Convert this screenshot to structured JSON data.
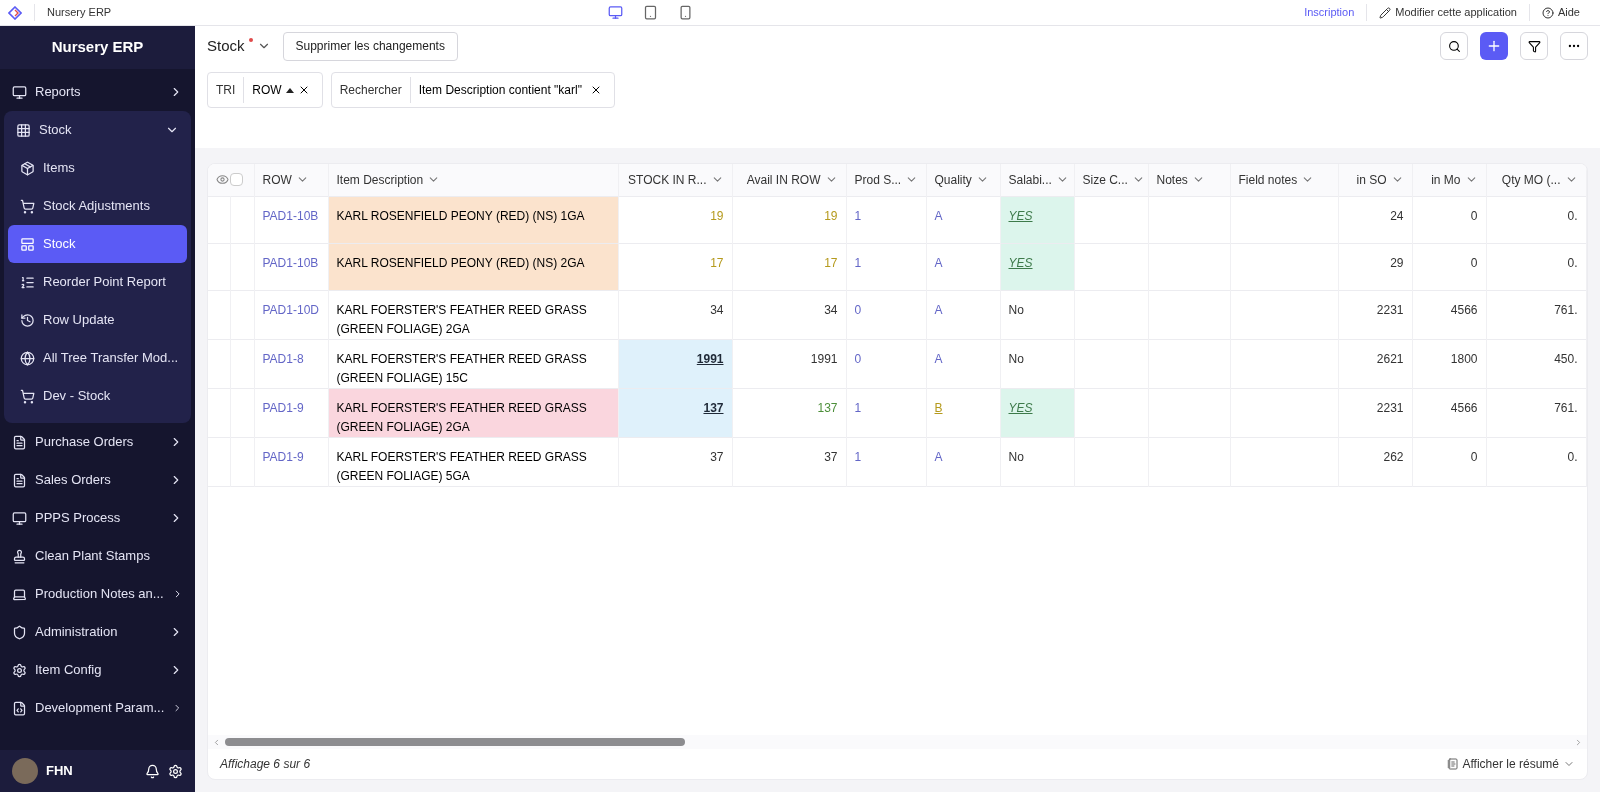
{
  "topbar": {
    "app_name": "Nursery ERP",
    "device_views": [
      {
        "kind": "desktop",
        "selected": true
      },
      {
        "kind": "tablet",
        "selected": false
      },
      {
        "kind": "phone",
        "selected": false
      }
    ],
    "signup": "Inscription",
    "edit_app": "Modifier cette application",
    "help": "Aide"
  },
  "sidebar": {
    "title": "Nursery ERP",
    "items": [
      {
        "label": "Reports",
        "expanded": false,
        "selected": false
      },
      {
        "label": "Stock",
        "expanded": true,
        "selected": false,
        "children": [
          {
            "label": "Items",
            "selected": false
          },
          {
            "label": "Stock Adjustments",
            "selected": false
          },
          {
            "label": "Stock",
            "selected": true
          },
          {
            "label": "Reorder Point Report",
            "selected": false
          },
          {
            "label": "Row Update",
            "selected": false
          },
          {
            "label": "All Tree Transfer Mod...",
            "selected": false
          },
          {
            "label": "Dev - Stock",
            "selected": false
          }
        ]
      },
      {
        "label": "Purchase Orders",
        "expanded": false,
        "selected": false
      },
      {
        "label": "Sales Orders",
        "expanded": false,
        "selected": false
      },
      {
        "label": "PPPS Process",
        "expanded": false,
        "selected": false
      },
      {
        "label": "Clean Plant Stamps",
        "selected": false
      },
      {
        "label": "Production Notes an...",
        "expanded": false,
        "selected": false
      },
      {
        "label": "Administration",
        "expanded": false,
        "selected": false
      },
      {
        "label": "Item Config",
        "expanded": false,
        "selected": false
      },
      {
        "label": "Development Param...",
        "expanded": false,
        "selected": false
      }
    ],
    "user": {
      "name": "FHN"
    }
  },
  "header": {
    "title": "Stock",
    "unsaved": true,
    "discard_button": "Supprimer les changements"
  },
  "filters": {
    "sort_label": "TRI",
    "sort_chip": "ROW",
    "sort_ascending": true,
    "search_label": "Rechercher",
    "search_chip": "Item Description contient \"karl\""
  },
  "table": {
    "all_selected": false,
    "columns": [
      "ROW",
      "Item Description",
      "STOCK IN R...",
      "Avail IN ROW",
      "Prod S...",
      "Quality",
      "Salabi...",
      "Size C...",
      "Notes",
      "Field notes",
      "in SO",
      "in Mo",
      "Qty MO (..."
    ],
    "rows": [
      {
        "row": "PAD1-10B",
        "description": {
          "text": "KARL ROSENFIELD PEONY (RED) (NS) 1GA",
          "color": "#fbe3cd"
        },
        "stock": {
          "text": "19",
          "kind": "number",
          "color": "#b59a1d"
        },
        "avail": {
          "text": "19",
          "color": "#b59a1d"
        },
        "prod": "1",
        "quality": {
          "text": "A",
          "kind": "plain",
          "color": "#6366c7"
        },
        "salability": "YES",
        "salable": true,
        "in_so": "24",
        "in_mo": "0",
        "qty_mo": "0."
      },
      {
        "row": "PAD1-10B",
        "description": {
          "text": "KARL ROSENFIELD PEONY (RED) (NS) 2GA",
          "color": "#fbe3cd"
        },
        "stock": {
          "text": "17",
          "kind": "number",
          "color": "#b59a1d"
        },
        "avail": {
          "text": "17",
          "color": "#b59a1d"
        },
        "prod": "1",
        "quality": {
          "text": "A",
          "kind": "plain",
          "color": "#6366c7"
        },
        "salability": "YES",
        "salable": true,
        "in_so": "29",
        "in_mo": "0",
        "qty_mo": "0."
      },
      {
        "row": "PAD1-10D",
        "description": {
          "text": "KARL FOERSTER'S FEATHER REED GRASS (GREEN FOLIAGE) 2GA"
        },
        "stock": {
          "text": "34",
          "kind": "number",
          "color": "#333333"
        },
        "avail": {
          "text": "34",
          "color": "#333333"
        },
        "prod": "0",
        "quality": {
          "text": "A",
          "kind": "plain",
          "color": "#6366c7"
        },
        "salability": "No",
        "salable": false,
        "in_so": "2231",
        "in_mo": "4566",
        "qty_mo": "761."
      },
      {
        "row": "PAD1-8",
        "description": {
          "text": "KARL FOERSTER'S FEATHER REED GRASS (GREEN FOLIAGE) 15C"
        },
        "stock": {
          "text": "1991",
          "kind": "link",
          "color": "#1f2937"
        },
        "avail": {
          "text": "1991",
          "color": "#333333"
        },
        "prod": "0",
        "quality": {
          "text": "A",
          "kind": "plain",
          "color": "#6366c7"
        },
        "salability": "No",
        "salable": false,
        "in_so": "2621",
        "in_mo": "1800",
        "qty_mo": "450."
      },
      {
        "row": "PAD1-9",
        "description": {
          "text": "KARL FOERSTER'S FEATHER REED GRASS (GREEN FOLIAGE) 2GA",
          "color": "#fad6de"
        },
        "stock": {
          "text": "137",
          "kind": "link",
          "color": "#1f2937"
        },
        "avail": {
          "text": "137",
          "color": "#4d8f3a"
        },
        "prod": "1",
        "quality": {
          "text": "B",
          "kind": "link",
          "color": "#b59a1d"
        },
        "salability": "YES",
        "salable": true,
        "in_so": "2231",
        "in_mo": "4566",
        "qty_mo": "761."
      },
      {
        "row": "PAD1-9",
        "description": {
          "text": "KARL FOERSTER'S FEATHER REED GRASS (GREEN FOLIAGE) 5GA"
        },
        "stock": {
          "text": "37",
          "kind": "number",
          "color": "#333333"
        },
        "avail": {
          "text": "37",
          "color": "#333333"
        },
        "prod": "1",
        "quality": {
          "text": "A",
          "kind": "plain",
          "color": "#6366c7"
        },
        "salability": "No",
        "salable": false,
        "in_so": "262",
        "in_mo": "0",
        "qty_mo": "0."
      }
    ]
  },
  "footer": {
    "count": "Affichage 6 sur 6",
    "summary_button": "Afficher le résumé"
  }
}
